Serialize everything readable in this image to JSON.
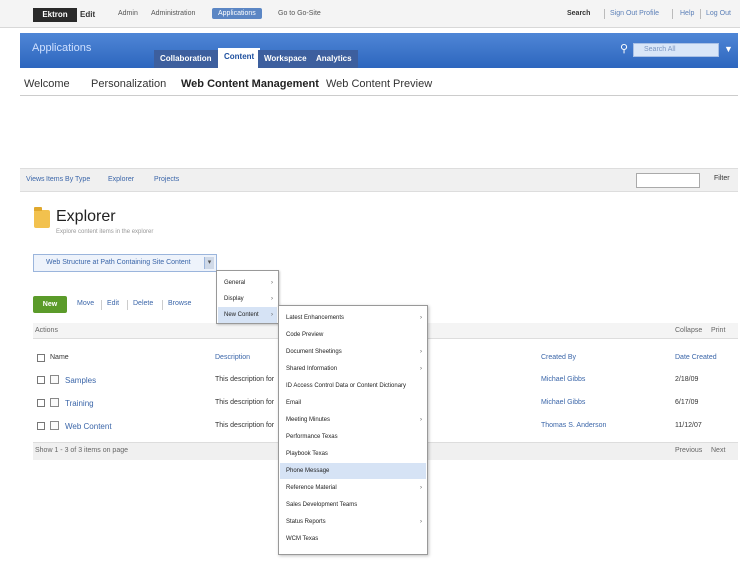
{
  "topbar": {
    "logo": "Ektron",
    "logo_sub": "Edit",
    "links": [
      "Admin",
      "Administration",
      "Applications",
      "Go to Go-Site"
    ],
    "user": "Search",
    "right_links": [
      "Sign Out Profile",
      "Help",
      "Log Out"
    ]
  },
  "appbar": {
    "title": "Applications",
    "tabs": [
      "Collaboration",
      "Content",
      "Workspace",
      "Analytics"
    ],
    "search_placeholder": "Search All"
  },
  "subnav": {
    "items": [
      "Welcome",
      "Personalization",
      "Web Content Management",
      "Web Content Preview"
    ]
  },
  "breadcrumb": {
    "items": [
      "Views",
      "Items By Type",
      "Explorer",
      "Projects"
    ],
    "filter_button": "Filter"
  },
  "explorer": {
    "title": "Explorer",
    "description": "Explore content items in the explorer",
    "selector": "Web Structure at Path Containing Site Content"
  },
  "actions": {
    "primary": "New",
    "buttons": [
      "Move",
      "Edit",
      "Delete",
      "Browse"
    ]
  },
  "table": {
    "header_left": "Actions",
    "header_right": [
      "Collapse",
      "Print"
    ],
    "columns": [
      "Name",
      "Description",
      "Created By",
      "Date Created"
    ],
    "rows": [
      {
        "name": "Name",
        "description": "Description",
        "created_by": "Created By",
        "date": "Date Created"
      },
      {
        "name": "Samples",
        "description": "This description for",
        "created_by": "Michael Gibbs",
        "date": "2/18/09"
      },
      {
        "name": "Training",
        "description": "This description for",
        "created_by": "Michael Gibbs",
        "date": "6/17/09"
      },
      {
        "name": "Web Content",
        "description": "This description for",
        "created_by": "Thomas S. Anderson",
        "date": "11/12/07"
      }
    ],
    "footer": "Show 1 - 3 of 3 items on page",
    "footer_right": [
      "Previous",
      "Next"
    ]
  },
  "menu1": {
    "items": [
      "General",
      "Display",
      "New Content"
    ]
  },
  "menu2": {
    "items": [
      {
        "label": "Latest Enhancements",
        "arrow": true
      },
      {
        "label": "Code Preview",
        "arrow": false
      },
      {
        "label": "Document Sheetings",
        "arrow": true
      },
      {
        "label": "Shared Information",
        "arrow": true
      },
      {
        "label": "ID Access Control Data or Content Dictionary",
        "arrow": false
      },
      {
        "label": "Email",
        "arrow": false
      },
      {
        "label": "Meeting Minutes",
        "arrow": true
      },
      {
        "label": "Performance Texas",
        "arrow": false
      },
      {
        "label": "Playbook Texas",
        "arrow": false
      },
      {
        "label": "Phone Message",
        "arrow": false,
        "highlight": true
      },
      {
        "label": "Reference Material",
        "arrow": true
      },
      {
        "label": "Sales Development Teams",
        "arrow": false
      },
      {
        "label": "Status Reports",
        "arrow": true
      },
      {
        "label": "WCM Texas",
        "arrow": false
      }
    ]
  }
}
